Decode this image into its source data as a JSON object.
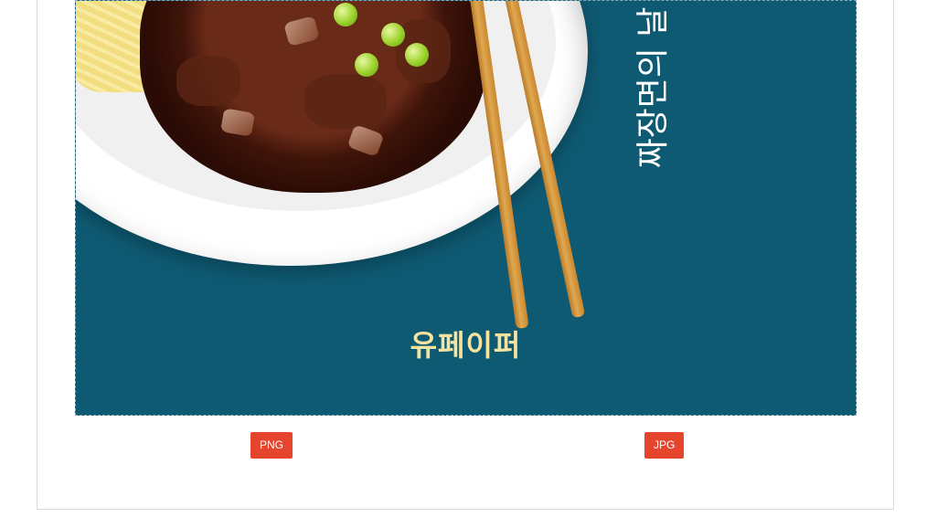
{
  "poster": {
    "brand": "유페이퍼",
    "vertical_text": "짜장면의 날",
    "colors": {
      "background": "#0e5a73",
      "accent": "#f7e3a0"
    }
  },
  "downloads": [
    {
      "label": "PNG",
      "color": "#e5452d"
    },
    {
      "label": "JPG",
      "color": "#e5452d"
    }
  ]
}
